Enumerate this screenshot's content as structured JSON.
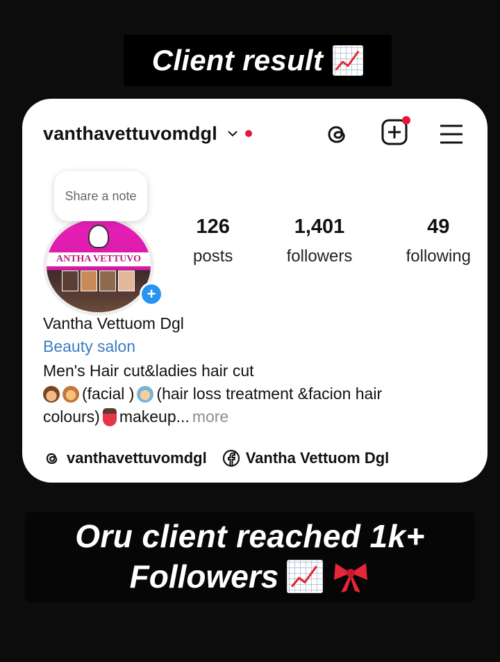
{
  "top_banner": {
    "text": "Client result",
    "emoji": "chart-increasing-icon"
  },
  "profile": {
    "username": "vanthavettuvomdgl",
    "note_text": "Share a note",
    "stats": [
      {
        "value": "126",
        "label": "posts"
      },
      {
        "value": "1,401",
        "label": "followers"
      },
      {
        "value": "49",
        "label": "following"
      }
    ],
    "avatar_brand_text": "ANTHA VETTUVO",
    "name": "Vantha Vettuom Dgl",
    "category": "Beauty salon",
    "bio_line1": "Men's Hair cut&ladies hair cut",
    "bio_line2_part1": "(facial )",
    "bio_line2_part2": "(hair loss treatment &facion hair",
    "bio_line3": "colours)",
    "bio_line3_end": "makeup...",
    "bio_more": "more",
    "links": [
      {
        "icon": "threads-icon",
        "label": "vanthavettuvomdgl"
      },
      {
        "icon": "facebook-icon",
        "label": "Vantha Vettuom Dgl"
      }
    ]
  },
  "bottom_banner": {
    "line1": "Oru client reached 1k+",
    "line2": "Followers"
  },
  "colors": {
    "background": "#0c0c0c",
    "card": "#ffffff",
    "category_link": "#3a7cc2",
    "notification_red": "#e8173a",
    "add_badge": "#2694f1"
  }
}
